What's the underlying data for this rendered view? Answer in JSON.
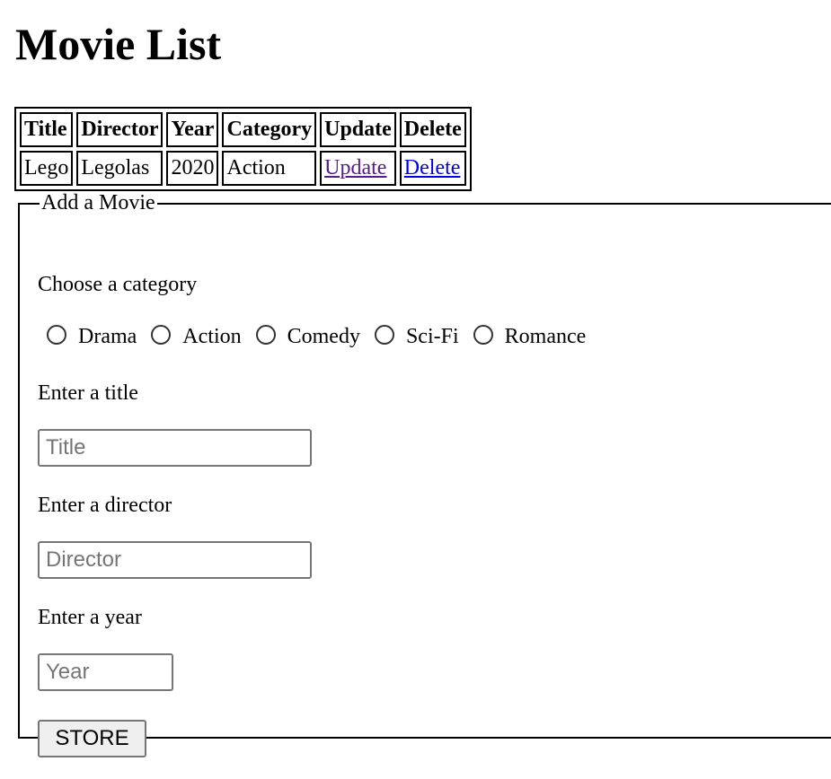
{
  "page": {
    "title": "Movie List"
  },
  "table": {
    "headers": [
      "Title",
      "Director",
      "Year",
      "Category",
      "Update",
      "Delete"
    ],
    "rows": [
      {
        "title": "Lego",
        "director": "Legolas",
        "year": "2020",
        "category": "Action",
        "update_link": "Update",
        "delete_link": "Delete"
      }
    ]
  },
  "form": {
    "legend": "Add a Movie",
    "category_label": "Choose a category",
    "categories": [
      "Drama",
      "Action",
      "Comedy",
      "Sci-Fi",
      "Romance"
    ],
    "title_label": "Enter a title",
    "title_placeholder": "Title",
    "director_label": "Enter a director",
    "director_placeholder": "Director",
    "year_label": "Enter a year",
    "year_placeholder": "Year",
    "store_label": "STORE"
  }
}
